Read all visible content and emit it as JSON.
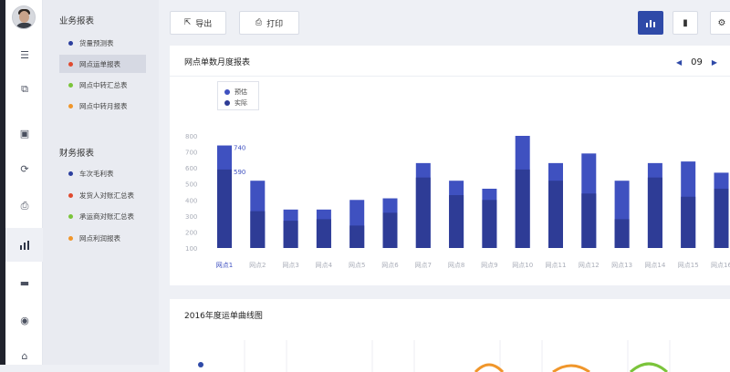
{
  "sidebar": {
    "icons": [
      "menu-icon",
      "box-icon",
      "truck-icon",
      "refresh-icon",
      "printer-icon",
      "bar-chart-icon",
      "message-icon",
      "user-icon",
      "report-icon"
    ]
  },
  "submenu": {
    "section1_title": "业务报表",
    "section1_items": [
      {
        "label": "货量预测表",
        "color": "#2c3f9e"
      },
      {
        "label": "网点运单报表",
        "color": "#e04a2f"
      },
      {
        "label": "网点中转汇总表",
        "color": "#7bc43b"
      },
      {
        "label": "网点中转月报表",
        "color": "#f0962b"
      }
    ],
    "section2_title": "财务报表",
    "section2_items": [
      {
        "label": "车次毛利表",
        "color": "#2c3f9e"
      },
      {
        "label": "发货人对账汇总表",
        "color": "#e04a2f"
      },
      {
        "label": "承运商对账汇总表",
        "color": "#7bc43b"
      },
      {
        "label": "网点利润报表",
        "color": "#f0962b"
      }
    ]
  },
  "toolbar": {
    "export_label": "导出",
    "print_label": "打印"
  },
  "card1": {
    "title": "网点单数月度报表",
    "month": "09"
  },
  "card2": {
    "title": "2016年度运单曲线图"
  },
  "colors": {
    "estimate": "#3f51c0",
    "actual": "#2e3c96",
    "accent": "#2f4aa8"
  },
  "chart_data": {
    "type": "bar",
    "title": "网点单数月度报表",
    "categories": [
      "网点1",
      "网点2",
      "网点3",
      "网点4",
      "网点5",
      "网点6",
      "网点7",
      "网点8",
      "网点9",
      "网点10",
      "网点11",
      "网点12",
      "网点13",
      "网点14",
      "网点15",
      "网点16"
    ],
    "series": [
      {
        "name": "预估",
        "values": [
          740,
          520,
          340,
          340,
          400,
          410,
          630,
          520,
          470,
          800,
          630,
          690,
          520,
          630,
          640,
          570
        ]
      },
      {
        "name": "实际",
        "values": [
          590,
          330,
          270,
          280,
          240,
          320,
          540,
          430,
          400,
          590,
          520,
          440,
          280,
          540,
          420,
          470
        ]
      }
    ],
    "data_labels": [
      "740",
      "590"
    ],
    "yticks": [
      100,
      200,
      300,
      400,
      500,
      600,
      700,
      800
    ],
    "ylim": [
      0,
      800
    ],
    "legend": "top-left",
    "grid": false
  }
}
